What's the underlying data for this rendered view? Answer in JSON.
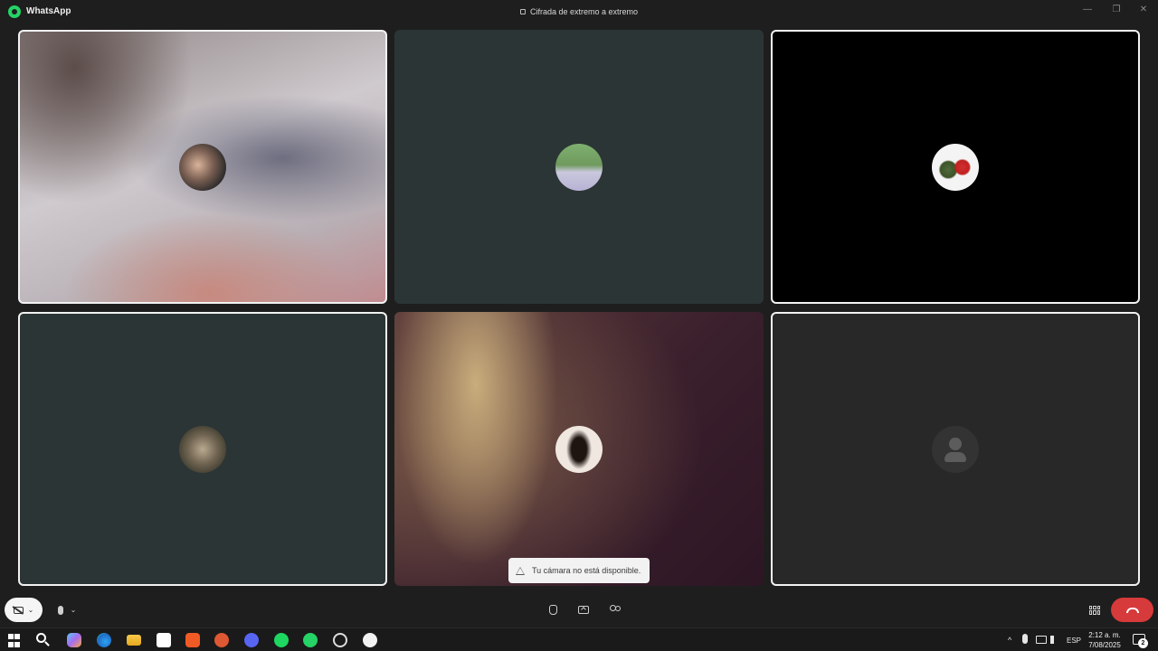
{
  "window": {
    "app_name": "WhatsApp",
    "encryption_text": "Cifrada de extremo a extremo",
    "minimize": "—",
    "restore": "❐",
    "close": "✕"
  },
  "participants": [
    {
      "id": "participant-1",
      "speaking": true,
      "camera": "blurred"
    },
    {
      "id": "participant-2",
      "speaking": false,
      "camera": "off"
    },
    {
      "id": "participant-3",
      "speaking": true,
      "camera": "off"
    },
    {
      "id": "participant-4",
      "speaking": true,
      "camera": "off"
    },
    {
      "id": "participant-5",
      "speaking": false,
      "camera": "blurred"
    },
    {
      "id": "participant-6",
      "speaking": true,
      "camera": "off",
      "avatar": "default"
    }
  ],
  "toast": {
    "text": "Tu cámara no está disponible.",
    "icon": "warning-icon"
  },
  "controls": {
    "camera_chevron": "⌄",
    "mic_chevron": "⌄"
  },
  "taskbar": {
    "language": "ESP",
    "time": "2:12 a. m.",
    "date": "7/08/2025",
    "notifications": "2",
    "tray_chevron": "^",
    "apps": [
      "start",
      "search",
      "copilot",
      "edge",
      "file-explorer",
      "store",
      "brave",
      "duckduckgo",
      "discord",
      "spotify",
      "whatsapp",
      "clock-app",
      "settings-app"
    ]
  },
  "colors": {
    "background": "#1e1e1e",
    "tile_dark": "#2c3535",
    "end_call": "#d63a3a",
    "whatsapp_green": "#25d366"
  }
}
